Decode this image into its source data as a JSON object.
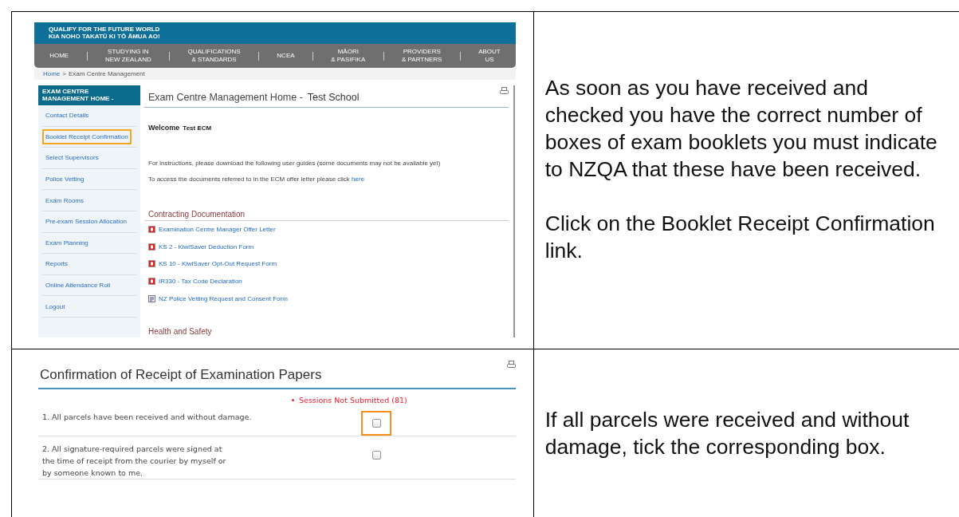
{
  "rows": [
    {
      "screenshot": {
        "kind": "home",
        "banner": {
          "tagline": "QUALIFY FOR THE FUTURE WORLD\nKIA NOHO TAKATŪ KI TŌ ĀMUA AO!"
        },
        "nav": [
          "HOME",
          "STUDYING IN\nNEW ZEALAND",
          "QUALIFICATIONS\n& STANDARDS",
          "NCEA",
          "MĀORI\n& PASIFIKA",
          "PROVIDERS\n& PARTNERS",
          "ABOUT\nUS"
        ],
        "breadcrumb": {
          "link": "Home",
          "separator": ">",
          "current": "Exam Centre Management"
        },
        "sidebar": {
          "header": "EXAM CENTRE MANAGEMENT HOME -",
          "items": [
            {
              "label": "Contact Details",
              "highlighted": false
            },
            {
              "label": "Booklet Receipt Confirmation",
              "highlighted": true
            },
            {
              "label": "Select Supervisors",
              "highlighted": false
            },
            {
              "label": "Police Vetting",
              "highlighted": false
            },
            {
              "label": "Exam Rooms",
              "highlighted": false
            },
            {
              "label": "Pre-exam Session Allocation",
              "highlighted": false
            },
            {
              "label": "Exam Planning",
              "highlighted": false
            },
            {
              "label": "Reports",
              "highlighted": false
            },
            {
              "label": "Online Attendance Roll",
              "highlighted": false
            },
            {
              "label": "Logout",
              "highlighted": false
            }
          ]
        },
        "title": "Exam Centre Management Home -",
        "school": "Test School",
        "welcome": "Welcome",
        "user": "Test ECM",
        "instructions": "For instructions, please download the following user guides (some documents may not be available yet)",
        "access_text": "To access the documents referred to in the ECM offer letter please click",
        "access_link": "here",
        "section": "Contracting Documentation",
        "documents": [
          {
            "kind": "pdf",
            "label": "Examination Centre Manager Offer Letter"
          },
          {
            "kind": "pdf",
            "label": "KS 2 - KiwiSaver Deduction Form"
          },
          {
            "kind": "pdf",
            "label": "KS 10 - KiwiSaver Opt-Out Request Form"
          },
          {
            "kind": "pdf",
            "label": "IR330 - Tax Code Declaration"
          },
          {
            "kind": "form",
            "label": "NZ Police Vetting Request and Consent Form"
          }
        ],
        "next_section": "Health and Safety"
      },
      "paragraphs": [
        "As soon as you have received and checked you have the correct number of boxes of exam booklets you must indicate to NZQA that these have been received.",
        "Click on the Booklet Receipt Confirmation link."
      ]
    },
    {
      "screenshot": {
        "kind": "confirmation",
        "title": "Confirmation of Receipt of Examination Papers",
        "status": "Sessions Not Submitted (81)",
        "items": [
          {
            "text": "1. All parcels have been received and without damage.",
            "checked": false,
            "highlighted": true
          },
          {
            "text": "2. All signature-required parcels were signed at\nthe time of receipt from the courier by myself or\nby someone known to me.",
            "checked": false,
            "highlighted": false
          }
        ]
      },
      "paragraphs": [
        "If all parcels were received and without damage, tick the corresponding box."
      ]
    }
  ]
}
